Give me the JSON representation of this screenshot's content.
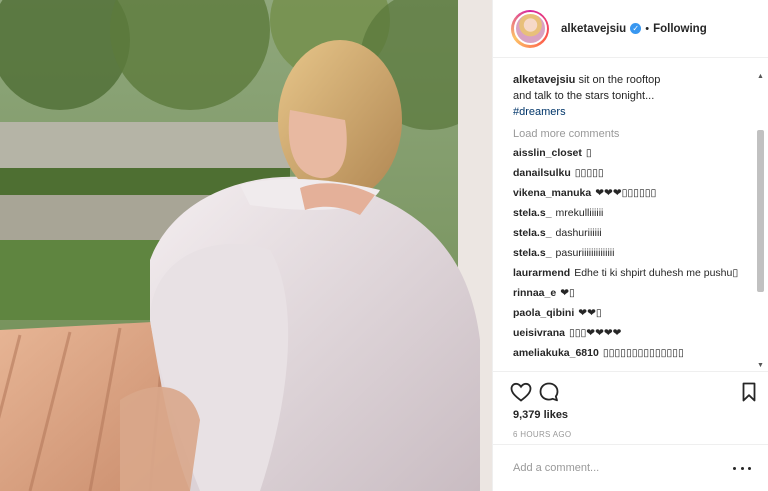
{
  "header": {
    "username": "alketavejsiu",
    "separator": "•",
    "follow_status": "Following",
    "verified_mark": "✓",
    "avatar_icon": "profile-avatar"
  },
  "caption": {
    "username": "alketavejsiu",
    "text_line1": "sit on the rooftop",
    "text_line2": "and talk to the stars tonight...",
    "hashtag": "#dreamers"
  },
  "load_more": "Load more comments",
  "comments": [
    {
      "username": "aisslin_closet",
      "text": "▯"
    },
    {
      "username": "danailsulku",
      "text": "▯▯▯▯▯"
    },
    {
      "username": "vikena_manuka",
      "text": "❤❤❤▯▯▯▯▯▯"
    },
    {
      "username": "stela.s_",
      "text": "mrekulliiiiii"
    },
    {
      "username": "stela.s_",
      "text": "dashuriiiiii"
    },
    {
      "username": "stela.s_",
      "text": "pasuriiiiiiiiiiiiii"
    },
    {
      "username": "laurarmend",
      "text": "Edhe ti ki shpirt duhesh me pushu▯"
    },
    {
      "username": "rinnaa_e",
      "text": "❤▯"
    },
    {
      "username": "paola_qibini",
      "text": "❤❤▯"
    },
    {
      "username": "ueisivrana",
      "text": "▯▯▯❤❤❤❤"
    },
    {
      "username": "ameliakuka_6810",
      "text": "▯▯▯▯▯▯▯▯▯▯▯▯▯▯"
    }
  ],
  "icons": {
    "like": "heart-outline-icon",
    "comment": "speech-bubble-icon",
    "save": "bookmark-icon",
    "more": "more-options-icon"
  },
  "likes": "9,379 likes",
  "timestamp": "6 HOURS AGO",
  "add_comment": {
    "placeholder": "Add a comment..."
  },
  "scrollbar": {
    "up_arrow": "▲",
    "down_arrow": "▼"
  },
  "colors": {
    "text": "#262626",
    "muted": "#999999",
    "hashtag": "#003569",
    "verified": "#3897f0",
    "border": "#efefef"
  }
}
